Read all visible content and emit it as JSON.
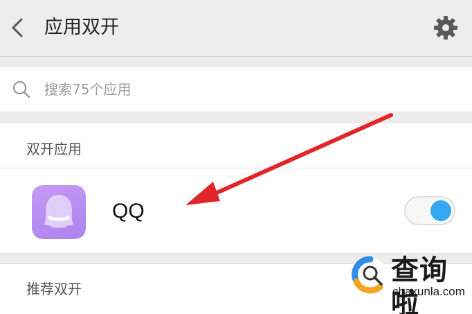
{
  "header": {
    "title": "应用双开",
    "back_icon": "chevron-left-icon",
    "settings_icon": "gear-icon"
  },
  "search": {
    "placeholder": "搜索75个应用",
    "icon": "search-icon"
  },
  "dual_apps": {
    "section_title": "双开应用",
    "apps": [
      {
        "name": "QQ",
        "icon": "qq-penguin-icon",
        "enabled": true
      }
    ]
  },
  "recommend": {
    "section_title": "推荐双开"
  },
  "annotation": {
    "arrow_color": "#e0262a"
  },
  "watermark": {
    "title": "查询啦",
    "url": "chaxunla.com"
  },
  "colors": {
    "accent": "#33a8f0",
    "qq_icon": "#b98cf2",
    "background": "#ececec"
  }
}
